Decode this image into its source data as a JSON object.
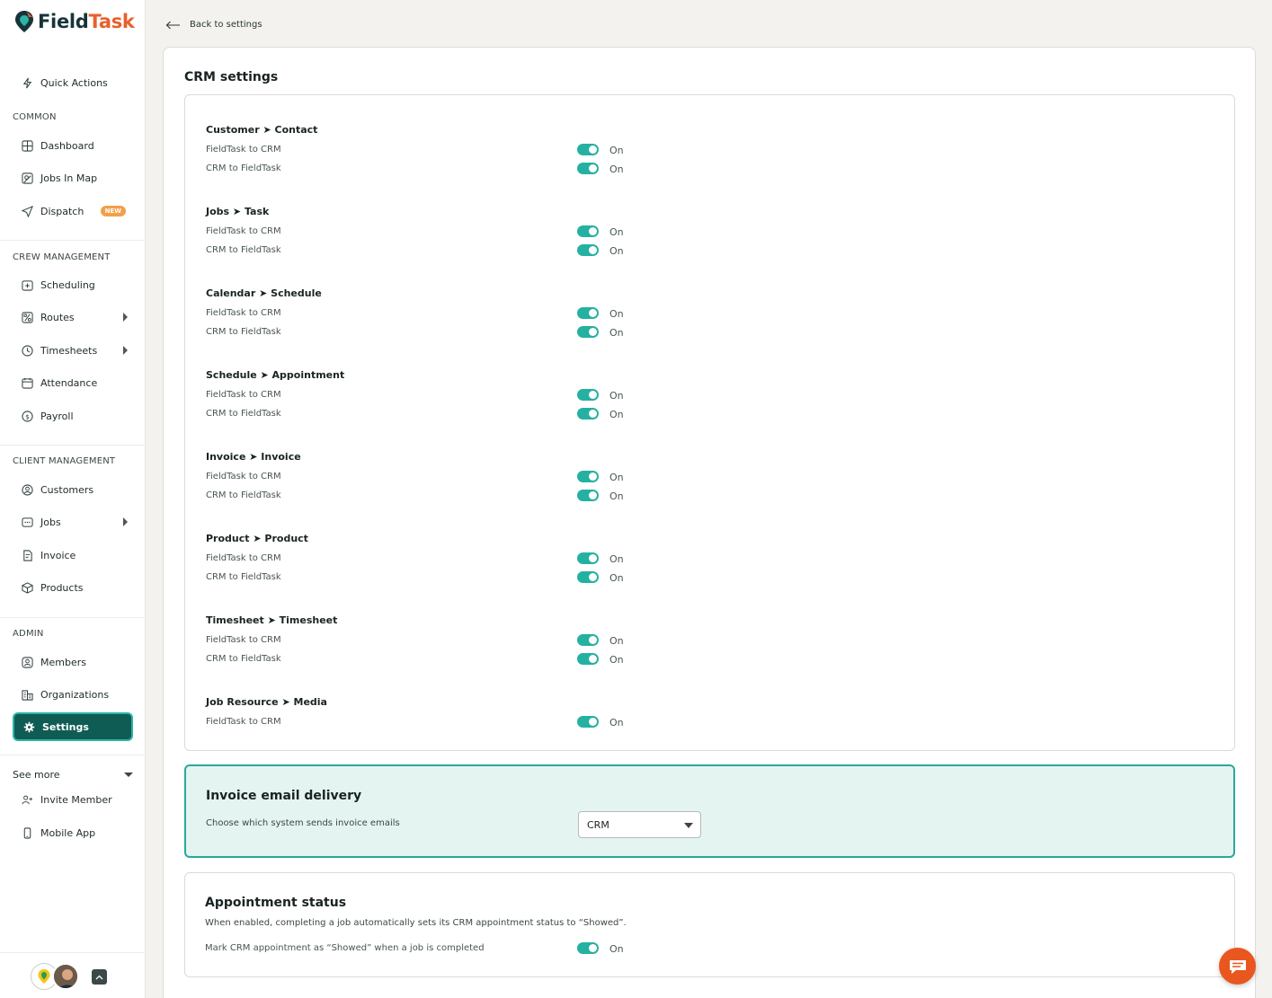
{
  "brand": {
    "name_part1": "Field",
    "name_part2": "Task",
    "accent_color": "#e8602c",
    "primary_color": "#0f5c55"
  },
  "sidebar": {
    "quick_actions": "Quick Actions",
    "sections": {
      "common": "COMMON",
      "crew": "CREW MANAGEMENT",
      "client": "CLIENT MANAGEMENT",
      "admin": "ADMIN"
    },
    "items": {
      "dashboard": "Dashboard",
      "jobs_in_map": "Jobs In Map",
      "dispatch": "Dispatch",
      "dispatch_badge": "NEW",
      "scheduling": "Scheduling",
      "routes": "Routes",
      "timesheets": "Timesheets",
      "attendance": "Attendance",
      "payroll": "Payroll",
      "customers": "Customers",
      "jobs": "Jobs",
      "invoice": "Invoice",
      "products": "Products",
      "members": "Members",
      "organizations": "Organizations",
      "settings": "Settings"
    },
    "see_more": "See more",
    "extra": {
      "invite_member": "Invite Member",
      "mobile_app": "Mobile App"
    }
  },
  "header": {
    "back_label": "Back to settings"
  },
  "crm": {
    "title": "CRM settings",
    "groups": [
      {
        "title": "Customer ➤ Contact",
        "rows": [
          {
            "label": "FieldTask to CRM",
            "state": "On"
          },
          {
            "label": "CRM to FieldTask",
            "state": "On"
          }
        ]
      },
      {
        "title": "Jobs ➤ Task",
        "rows": [
          {
            "label": "FieldTask to CRM",
            "state": "On"
          },
          {
            "label": "CRM to FieldTask",
            "state": "On"
          }
        ]
      },
      {
        "title": "Calendar ➤ Schedule",
        "rows": [
          {
            "label": "FieldTask to CRM",
            "state": "On"
          },
          {
            "label": "CRM to FieldTask",
            "state": "On"
          }
        ]
      },
      {
        "title": "Schedule ➤ Appointment",
        "rows": [
          {
            "label": "FieldTask to CRM",
            "state": "On"
          },
          {
            "label": "CRM to FieldTask",
            "state": "On"
          }
        ]
      },
      {
        "title": "Invoice ➤ Invoice",
        "rows": [
          {
            "label": "FieldTask to CRM",
            "state": "On"
          },
          {
            "label": "CRM to FieldTask",
            "state": "On"
          }
        ]
      },
      {
        "title": "Product ➤ Product",
        "rows": [
          {
            "label": "FieldTask to CRM",
            "state": "On"
          },
          {
            "label": "CRM to FieldTask",
            "state": "On"
          }
        ]
      },
      {
        "title": "Timesheet ➤ Timesheet",
        "rows": [
          {
            "label": "FieldTask to CRM",
            "state": "On"
          },
          {
            "label": "CRM to FieldTask",
            "state": "On"
          }
        ]
      },
      {
        "title": "Job Resource ➤ Media",
        "rows": [
          {
            "label": "FieldTask to CRM",
            "state": "On"
          }
        ]
      }
    ]
  },
  "invoice_delivery": {
    "title": "Invoice email delivery",
    "description": "Choose which system sends invoice emails",
    "selected": "CRM"
  },
  "appointment_status": {
    "title": "Appointment status",
    "description": "When enabled, completing a job automatically sets its CRM appointment status to “Showed”.",
    "row_label": "Mark CRM appointment as “Showed” when a job is completed",
    "state": "On"
  }
}
